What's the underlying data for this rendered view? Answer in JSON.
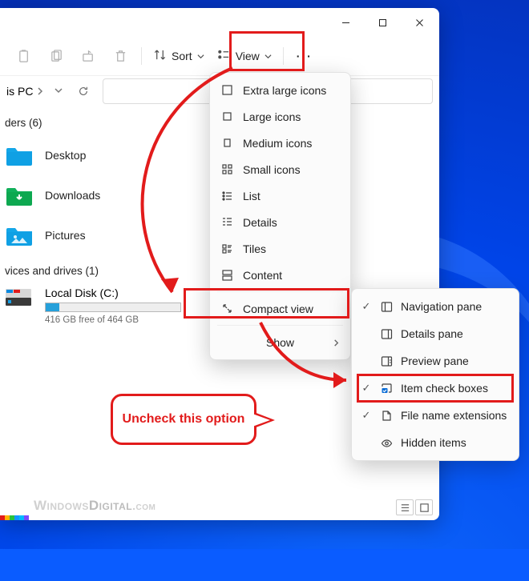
{
  "window": {
    "title": ""
  },
  "toolbar": {
    "sort_label": "Sort",
    "view_label": "View"
  },
  "address": {
    "crumb": "is PC",
    "chevron": "›"
  },
  "sections": {
    "folders_header": "ders (6)",
    "drives_header": "vices and drives (1)"
  },
  "folders": [
    {
      "name": "Desktop"
    },
    {
      "name": "Downloads"
    },
    {
      "name": "Pictures"
    }
  ],
  "drive": {
    "name": "Local Disk (C:)",
    "subtext": "416 GB free of 464 GB"
  },
  "view_menu": [
    {
      "label": "Extra large icons",
      "icon": "xl"
    },
    {
      "label": "Large icons",
      "icon": "lg"
    },
    {
      "label": "Medium icons",
      "icon": "md"
    },
    {
      "label": "Small icons",
      "icon": "sm"
    },
    {
      "label": "List",
      "icon": "list"
    },
    {
      "label": "Details",
      "icon": "details"
    },
    {
      "label": "Tiles",
      "icon": "tiles"
    },
    {
      "label": "Content",
      "icon": "content"
    }
  ],
  "view_menu_compact": "Compact view",
  "view_menu_show": "Show",
  "show_menu": [
    {
      "label": "Navigation pane",
      "checked": true
    },
    {
      "label": "Details pane",
      "checked": false
    },
    {
      "label": "Preview pane",
      "checked": false
    },
    {
      "label": "Item check boxes",
      "checked": true,
      "highlight": true
    },
    {
      "label": "File name extensions",
      "checked": true
    },
    {
      "label": "Hidden items",
      "checked": false
    }
  ],
  "callout_text": "Uncheck this option",
  "watermark": {
    "a": "Windows",
    "b": "Digital",
    ".c": ".com"
  },
  "stripe_colors": [
    "#e21b1b",
    "#ffb300",
    "#28c23a",
    "#1496ff",
    "#00b8ff",
    "#7a4bff"
  ]
}
